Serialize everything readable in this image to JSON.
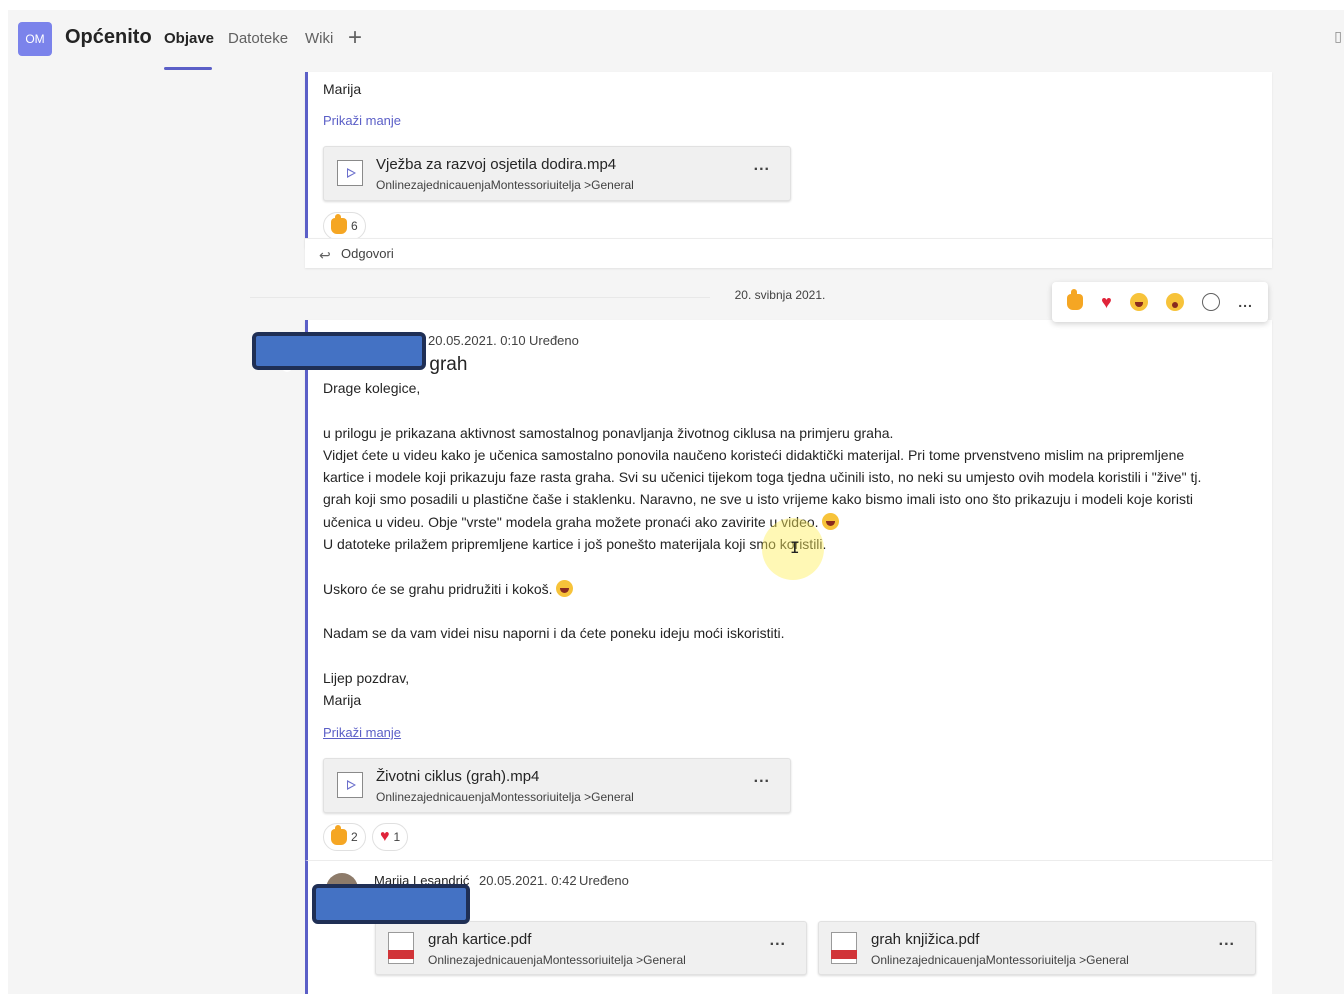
{
  "header": {
    "team_initials": "OM",
    "channel_name": "Općenito",
    "tabs": [
      {
        "label": "Objave",
        "active": true
      },
      {
        "label": "Datoteke",
        "active": false
      },
      {
        "label": "Wiki",
        "active": false
      }
    ],
    "add_tab_symbol": "+"
  },
  "accent_color": "#5b5fc7",
  "message1": {
    "signature": "Marija",
    "show_less": "Prikaži manje",
    "attachment": {
      "title": "Vježba za razvoj osjetila dodira.mp4",
      "path": "OnlinezajednicauenjaMontessoriuitelja >General",
      "more": "..."
    },
    "reactions": [
      {
        "type": "like",
        "count": "6"
      }
    ],
    "reply_label": "Odgovori"
  },
  "date_divider": "20. svibnja 2021.",
  "reaction_bar": {
    "icons": [
      "like-icon",
      "heart-icon",
      "laugh-icon",
      "surprised-icon",
      "add-reaction-icon"
    ],
    "more": "..."
  },
  "message2": {
    "timestamp": "20.05.2021. 0:10",
    "edited": "Uređeno",
    "title_visible": "s - grah",
    "greeting": "Drage kolegice,",
    "body_lines": [
      "u prilogu je prikazana aktivnost samostalnog ponavljanja životnog ciklusa na primjeru graha.",
      "Vidjet ćete u videu kako je učenica samostalno ponovila naučeno koristeći didaktički materijal. Pri tome prvenstveno mislim na pripremljene",
      "kartice i modele koji prikazuju faze rasta graha. Svi su učenici tijekom toga tjedna učinili isto, no neki su umjesto ovih modela koristili i \"žive\" tj.",
      "grah koji smo posadili u plastične čaše i staklenku. Naravno, ne sve u isto vrijeme kako bismo imali isto ono što prikazuju i modeli koje koristi",
      "učenica u videu. Obje \"vrste\" modela graha možete pronaći ako zavirite u video.",
      "U datoteke prilažem pripremljene kartice i još ponešto materijala koji smo koristili."
    ],
    "line_soon": "Uskoro će se grahu pridružiti i kokoš.",
    "line_hope": "Nadam se da vam videi nisu naporni i da ćete poneku ideju moći iskoristiti.",
    "closing": "Lijep pozdrav,",
    "signature": "Marija",
    "show_less": "Prikaži manje",
    "attachment": {
      "title": "Životni ciklus (grah).mp4",
      "path": "OnlinezajednicauenjaMontessoriuitelja >General",
      "more": "..."
    },
    "reactions": [
      {
        "type": "like",
        "count": "2"
      },
      {
        "type": "heart",
        "count": "1"
      }
    ]
  },
  "reply1": {
    "author": "Marija Lesandrić",
    "timestamp": "20.05.2021. 0:42",
    "edited": "Uređeno",
    "attachments": [
      {
        "title": "grah kartice.pdf",
        "path": "OnlinezajednicauenjaMontessoriuitelja >General",
        "more": "..."
      },
      {
        "title": "grah knjižica.pdf",
        "path": "OnlinezajednicauenjaMontessoriuitelja >General",
        "more": "..."
      }
    ]
  }
}
